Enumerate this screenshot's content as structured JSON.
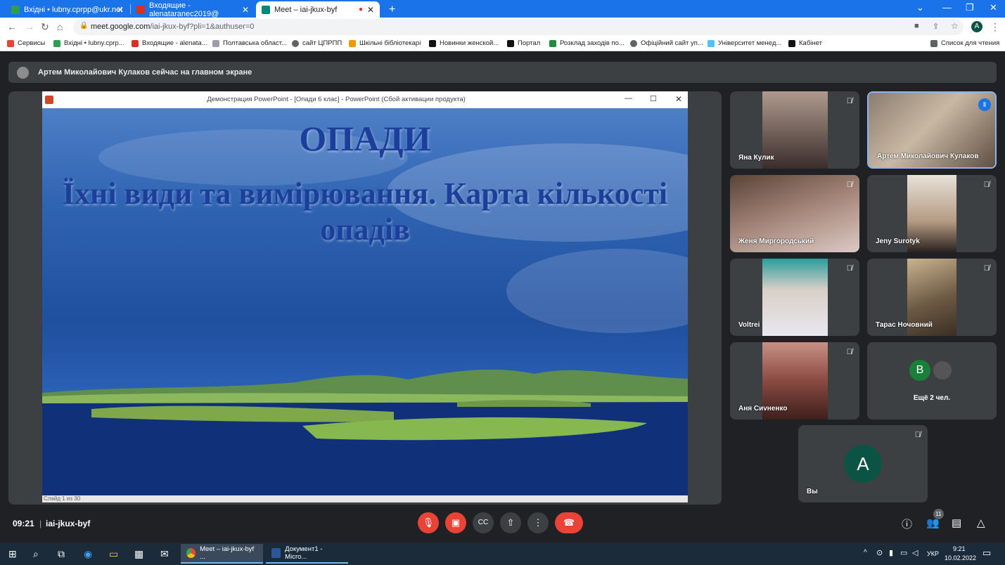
{
  "browser": {
    "tabs": [
      {
        "label": "Вхідні • lubny.cprpp@ukr.net",
        "active": false
      },
      {
        "label": "Входящие - alenataranec2019@",
        "active": false
      },
      {
        "label": "Meet – iai-jkux-byf",
        "active": true
      }
    ],
    "new_tab": "+",
    "url_main": "meet.google.com",
    "url_rest": "/iai-jkux-byf?pli=1&authuser=0",
    "profile_initial": "A",
    "bookmarks": [
      "Сервисы",
      "Вхідні • lubny.cprp...",
      "Входящие - alenata...",
      "Полтавська област...",
      "сайт ЦПРПП",
      "Шкільні бібліотекарі",
      "Новинки женской...",
      "Портал",
      "Розклад заходів по...",
      "Офіційний сайт уп...",
      "Університет менед...",
      "Кабінет"
    ],
    "reading_list": "Список для чтения"
  },
  "meet": {
    "banner": "Артем Миколайович Кулаков сейчас на главном экране",
    "presentation": {
      "window_title": "Демонстрация PowerPoint - [Опади 6 клас] - PowerPoint (Сбой активации продукта)",
      "slide_title": "ОПАДИ",
      "slide_subtitle": "Їхні види та вимірювання. Карта кількості опадів",
      "status": "Слайд 1 из 30"
    },
    "participants": [
      {
        "name": "Яна Кулик"
      },
      {
        "name": "Артем Миколайович Кулаков"
      },
      {
        "name": "Женя Миргородський"
      },
      {
        "name": "Jeny Surotyk"
      },
      {
        "name": "Voltrei"
      },
      {
        "name": "Тарас Ночовний"
      },
      {
        "name": "Аня Сиvненко"
      },
      {
        "name": "Ещё 2 чел.",
        "initial": "B"
      },
      {
        "name": "Вы",
        "initial": "A"
      }
    ],
    "time": "09:21",
    "meeting_code": "iai-jkux-byf",
    "participant_count": "11"
  },
  "taskbar": {
    "apps": [
      "Meet – iai-jkux-byf ...",
      "Документ1 - Micro..."
    ],
    "lang": "УКР",
    "time": "9:21",
    "date": "10.02.2022"
  },
  "colors": {
    "chrome_blue": "#1a73e8",
    "meet_bg": "#202124",
    "tile_bg": "#3c4043",
    "end_call": "#ea4335"
  }
}
